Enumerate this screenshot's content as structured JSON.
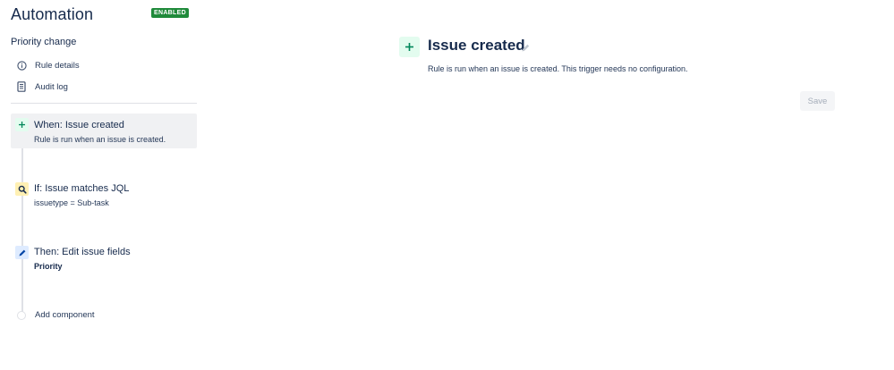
{
  "app": {
    "title": "Automation",
    "status_badge": "ENABLED"
  },
  "sidebar": {
    "rule_name": "Priority change",
    "nav": [
      {
        "label": "Rule details",
        "icon": "info-icon"
      },
      {
        "label": "Audit log",
        "icon": "document-icon"
      }
    ],
    "components": [
      {
        "title": "When: Issue created",
        "subtitle": "Rule is run when an issue is created.",
        "icon": "plus-icon",
        "active": true
      },
      {
        "title": "If: Issue matches JQL",
        "subtitle": "issuetype = Sub-task",
        "icon": "search-icon"
      },
      {
        "title": "Then: Edit issue fields",
        "subtitle": "Priority",
        "icon": "pencil-icon"
      }
    ],
    "add_component_label": "Add component"
  },
  "main": {
    "title": "Issue created",
    "description": "Rule is run when an issue is created. This trigger needs no configuration.",
    "save_label": "Save"
  },
  "colors": {
    "badge": "#1f8a3a",
    "trigger_bg": "#e3fcef",
    "trigger_fg": "#00875a",
    "condition_bg": "#fff0b3",
    "action_bg": "#deebff",
    "active_bg": "#f0f1f3"
  }
}
